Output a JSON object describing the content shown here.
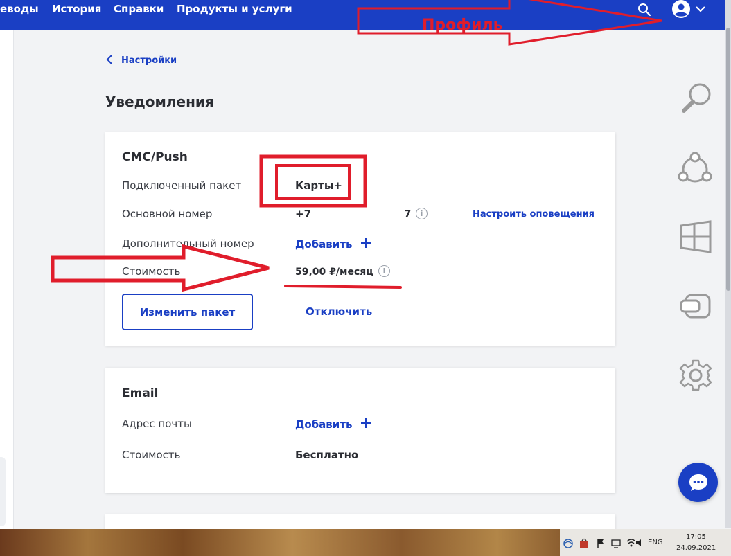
{
  "nav": {
    "links": [
      "еводы",
      "История",
      "Справки",
      "Продукты и услуги"
    ],
    "search_icon": "search-icon",
    "avatar_icon": "user-avatar-icon"
  },
  "annotation": {
    "profile_label": "Профиль"
  },
  "back": {
    "label": "Настройки"
  },
  "page": {
    "title": "Уведомления"
  },
  "sms_card": {
    "title": "СМС/Push",
    "package_label": "Подключенный пакет",
    "package_value": "Карты+",
    "main_number_label": "Основной номер",
    "main_number_prefix": "+7",
    "main_number_suffix": "7",
    "configure_link": "Настроить оповещения",
    "extra_number_label": "Дополнительный номер",
    "add_label": "Добавить",
    "cost_label": "Стоимость",
    "cost_value": "59,00 ₽/месяц",
    "change_button": "Изменить пакет",
    "disable_link": "Отключить"
  },
  "email_card": {
    "title": "Email",
    "address_label": "Адрес почты",
    "add_label": "Добавить",
    "cost_label": "Стоимость",
    "cost_value": "Бесплатно"
  },
  "sidebar_icons": [
    "search-icon",
    "ubuntu-icon",
    "windows-icon",
    "window-switch-icon",
    "gear-icon"
  ],
  "taskbar": {
    "language": "ENG",
    "time": "17:05",
    "date": "24.09.2021"
  },
  "colors": {
    "brand": "#1a3fc4",
    "annotation": "#e01d2b"
  }
}
